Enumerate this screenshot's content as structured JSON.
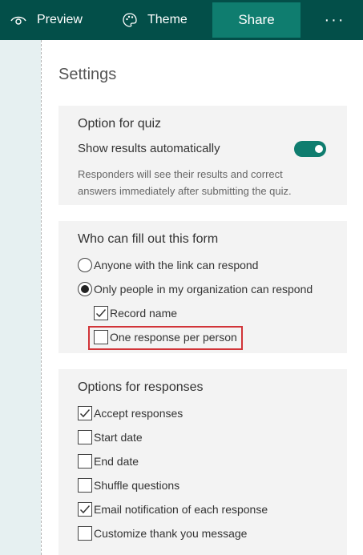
{
  "toolbar": {
    "preview_label": "Preview",
    "theme_label": "Theme",
    "share_label": "Share",
    "more_label": "···"
  },
  "settings": {
    "title": "Settings",
    "quiz": {
      "title": "Option for quiz",
      "show_results_label": "Show results automatically",
      "show_results_on": true,
      "description_line1": "Responders will see their results and correct",
      "description_line2": "answers immediately after submitting the quiz."
    },
    "who": {
      "title": "Who can fill out this form",
      "options": [
        {
          "label": "Anyone with the link can respond",
          "selected": false
        },
        {
          "label": "Only people in my organization can respond",
          "selected": true
        }
      ],
      "sub_options": [
        {
          "label": "Record name",
          "checked": true
        },
        {
          "label": "One response per person",
          "checked": false
        }
      ]
    },
    "responses": {
      "title": "Options for responses",
      "options": [
        {
          "label": "Accept responses",
          "checked": true
        },
        {
          "label": "Start date",
          "checked": false
        },
        {
          "label": "End date",
          "checked": false
        },
        {
          "label": "Shuffle questions",
          "checked": false
        },
        {
          "label": "Email notification of each response",
          "checked": true
        },
        {
          "label": "Customize thank you message",
          "checked": false
        }
      ]
    }
  },
  "colors": {
    "toolbar_bg": "#034f49",
    "share_bg": "#0f7d6f",
    "toggle_on": "#0f7d6f",
    "highlight": "#d13438"
  }
}
